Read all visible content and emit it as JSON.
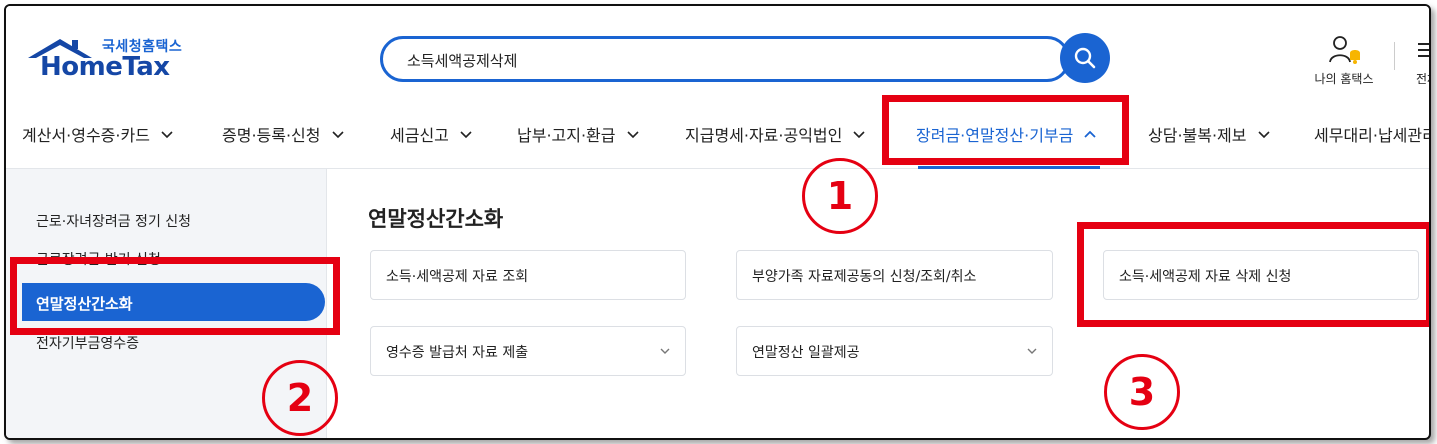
{
  "logo": {
    "sub": "국세청홈택스",
    "main": "HomeTax"
  },
  "search": {
    "value": "소득세액공제삭제"
  },
  "header": {
    "my_hometax": "나의 홈택스",
    "all_menu": "전체"
  },
  "nav": [
    {
      "label": "계산서·영수증·카드"
    },
    {
      "label": "증명·등록·신청"
    },
    {
      "label": "세금신고"
    },
    {
      "label": "납부·고지·환급"
    },
    {
      "label": "지급명세·자료·공익법인"
    },
    {
      "label": "장려금·연말정산·기부금",
      "active": true
    },
    {
      "label": "상담·불복·제보"
    },
    {
      "label": "세무대리·납세관리"
    }
  ],
  "sidebar": {
    "items": [
      {
        "label": "근로·자녀장려금 정기 신청"
      },
      {
        "label": "근로장려금 반기 신청"
      },
      {
        "label": "연말정산간소화",
        "active": true
      },
      {
        "label": "전자기부금영수증"
      }
    ]
  },
  "main": {
    "title": "연말정산간소화",
    "cards": [
      {
        "label": "소득·세액공제 자료 조회"
      },
      {
        "label": "부양가족 자료제공동의 신청/조회/취소"
      },
      {
        "label": "소득·세액공제 자료 삭제 신청"
      },
      {
        "label": "영수증 발급처 자료 제출"
      },
      {
        "label": "연말정산 일괄제공"
      }
    ]
  },
  "annotations": {
    "n1": "1",
    "n2": "2",
    "n3": "3"
  },
  "colors": {
    "accent": "#1a64d2",
    "brand_dark": "#1547a6",
    "annotation": "#e50012"
  }
}
